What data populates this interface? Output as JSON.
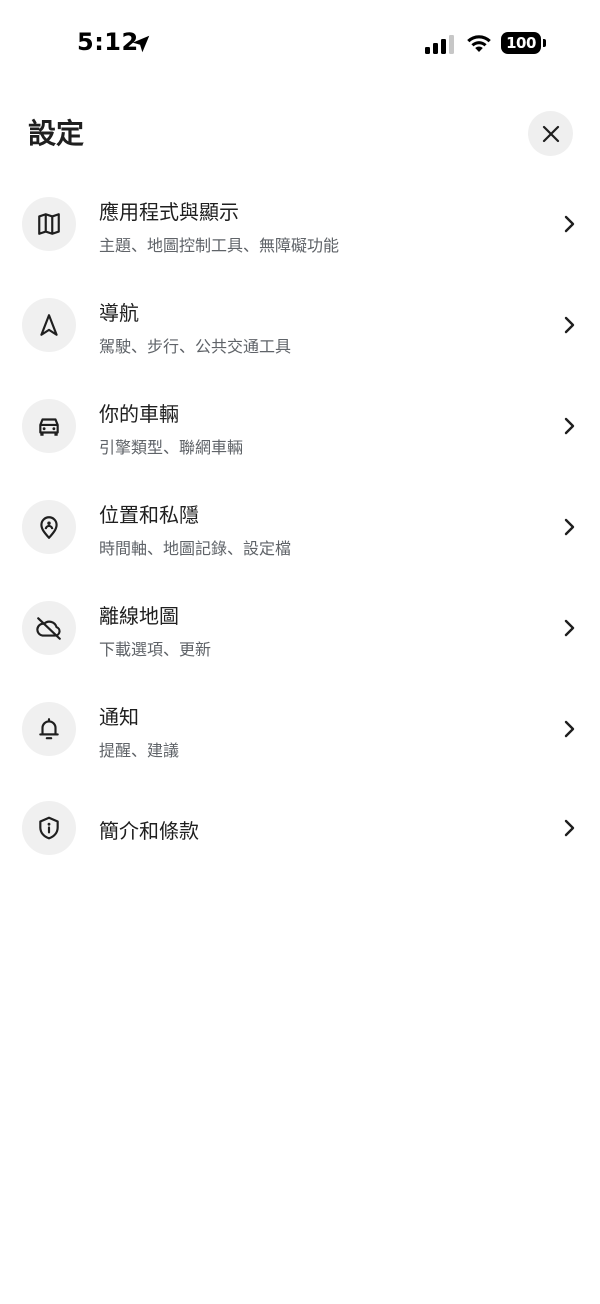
{
  "status_bar": {
    "time": "5:12",
    "battery": "100",
    "icons": [
      "location-arrow-icon",
      "cellular-signal-icon",
      "wifi-icon",
      "battery-icon"
    ]
  },
  "header": {
    "title": "設定",
    "close_icon": "close-icon"
  },
  "settings": [
    {
      "icon": "map-icon",
      "title": "應用程式與顯示",
      "subtitle": "主題、地圖控制工具、無障礙功能"
    },
    {
      "icon": "navigation-arrow-icon",
      "title": "導航",
      "subtitle": "駕駛、步行、公共交通工具"
    },
    {
      "icon": "car-icon",
      "title": "你的車輛",
      "subtitle": "引擎類型、聯網車輛"
    },
    {
      "icon": "location-privacy-pin-icon",
      "title": "位置和私隱",
      "subtitle": "時間軸、地圖記錄、設定檔"
    },
    {
      "icon": "cloud-off-icon",
      "title": "離線地圖",
      "subtitle": "下載選項、更新"
    },
    {
      "icon": "bell-icon",
      "title": "通知",
      "subtitle": "提醒、建議"
    },
    {
      "icon": "shield-info-icon",
      "title": "簡介和條款",
      "subtitle": ""
    }
  ],
  "colors": {
    "background": "#ffffff",
    "icon_circle": "#f0f0f0",
    "title_text": "#1f1f1f",
    "subtitle_text": "#5f6368"
  }
}
